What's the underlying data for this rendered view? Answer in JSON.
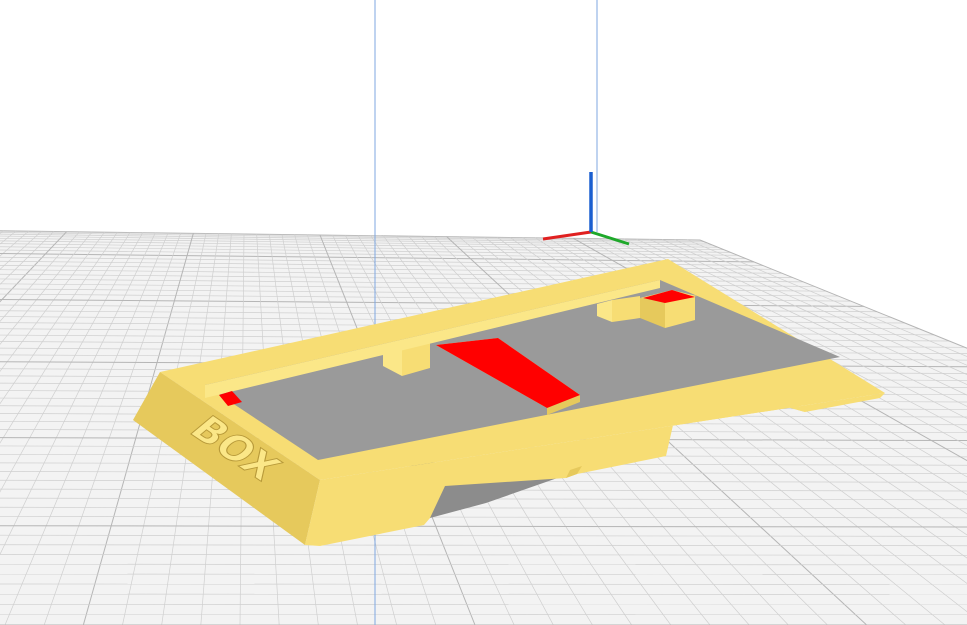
{
  "viewport": {
    "background_color": "#ffffff",
    "build_plate": {
      "fill_color": "#f3f3f3",
      "grid_minor_color": "#cfcfcf",
      "grid_major_color": "#b5b5b5"
    },
    "build_volume_edge_color": "#7fa7e0"
  },
  "axes_gizmo": {
    "x_color": "#e02020",
    "y_color": "#1ea82a",
    "z_color": "#1a5fd0"
  },
  "model": {
    "body_color": "#f7dd74",
    "face_light_color": "#fbe788",
    "face_dark_color": "#e6c95c",
    "overhang_color": "#ff0000",
    "shadow_color": "#8c8c8c",
    "embossed_text": "BOX"
  }
}
